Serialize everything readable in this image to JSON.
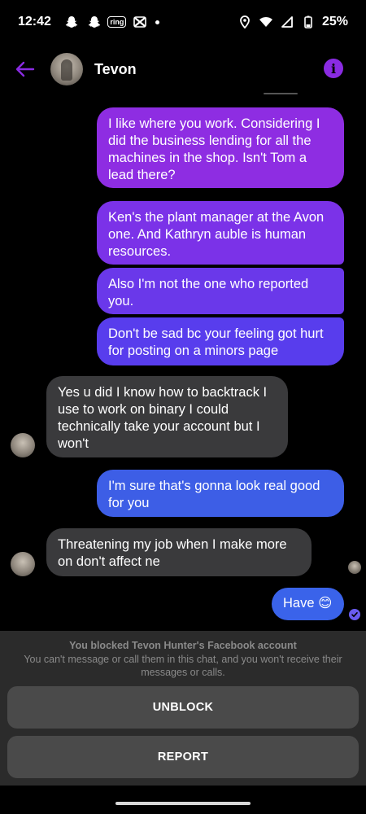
{
  "status_bar": {
    "time": "12:42",
    "ring_label": "ring",
    "battery": "25%",
    "icons": [
      "snapchat-icon",
      "snapchat-icon",
      "ring-icon",
      "capcut-icon",
      "location-icon",
      "wifi-icon",
      "signal-icon",
      "battery-icon"
    ]
  },
  "header": {
    "contact_name": "Tevon",
    "back_icon": "arrow-left-icon",
    "info_icon": "info-icon",
    "accent_color": "#8a2be2"
  },
  "messages": [
    {
      "direction": "out",
      "text": "I like where you work. Considering I did the business lending for all the machines in the shop. Isn't Tom a lead there?"
    },
    {
      "direction": "out",
      "text": "Ken's the plant manager at the Avon one. And Kathryn auble is human resources."
    },
    {
      "direction": "out",
      "text": "Also I'm not the one who reported you."
    },
    {
      "direction": "out",
      "text": "Don't be sad bc your feeling got hurt for posting on a minors page"
    },
    {
      "direction": "in",
      "text": "Yes u did I know how to backtrack I use to work on binary I could technically take your account but I won't"
    },
    {
      "direction": "out",
      "text": "I'm sure that's gonna look real good for you"
    },
    {
      "direction": "in",
      "text": "Threatening my job when I make more on don't affect ne"
    },
    {
      "direction": "out",
      "text": "Have 😊"
    }
  ],
  "blocked": {
    "title": "You blocked Tevon Hunter's Facebook account",
    "description": "You can't message or call them in this chat, and you won't receive their messages or calls.",
    "unblock_label": "UNBLOCK",
    "report_label": "REPORT"
  },
  "colors": {
    "bubble_purple": "#8e2de2",
    "bubble_blue": "#3d5ee6",
    "bubble_incoming": "#3a3a3c",
    "panel_bg": "#2b2b2b",
    "button_bg": "#4a4a4a"
  }
}
